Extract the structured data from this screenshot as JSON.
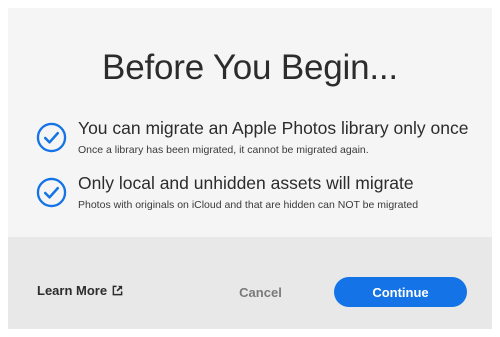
{
  "dialog": {
    "title": "Before You Begin...",
    "items": [
      {
        "title": "You can migrate an Apple Photos library only once",
        "description": "Once a library has been migrated, it cannot be migrated again.",
        "icon": "check-circle-icon"
      },
      {
        "title": "Only local and unhidden assets will migrate",
        "description": "Photos with originals on iCloud and that are hidden can NOT be migrated",
        "icon": "check-circle-icon"
      }
    ]
  },
  "footer": {
    "learn_more_label": "Learn More",
    "learn_more_icon": "external-link-icon",
    "cancel_label": "Cancel",
    "continue_label": "Continue"
  },
  "colors": {
    "accent": "#1473e6",
    "dialog_background": "#f5f5f5",
    "footer_background": "#e8e8e8",
    "text": "#2c2c2c",
    "muted_text": "#7a7a7a"
  }
}
